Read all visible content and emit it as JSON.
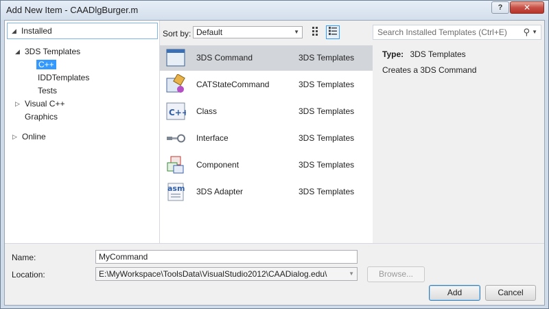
{
  "window": {
    "title": "Add New Item - CAADlgBurger.m",
    "help_label": "?",
    "close_label": "✕"
  },
  "tree": {
    "header": "Installed",
    "items": [
      {
        "label": "3DS Templates",
        "expanded": true
      },
      {
        "label": "C++",
        "selected": true
      },
      {
        "label": "IDDTemplates"
      },
      {
        "label": "Tests"
      },
      {
        "label": "Visual C++",
        "expanded": false
      },
      {
        "label": "Graphics"
      },
      {
        "label": "Online",
        "expanded": false
      }
    ]
  },
  "sortbar": {
    "label": "Sort by:",
    "value": "Default"
  },
  "templates": [
    {
      "name": "3DS Command",
      "category": "3DS Templates",
      "icon": "window-icon",
      "selected": true
    },
    {
      "name": "CATStateCommand",
      "category": "3DS Templates",
      "icon": "state-command-icon"
    },
    {
      "name": "Class",
      "category": "3DS Templates",
      "icon": "cpp-class-icon"
    },
    {
      "name": "Interface",
      "category": "3DS Templates",
      "icon": "interface-icon"
    },
    {
      "name": "Component",
      "category": "3DS Templates",
      "icon": "component-icon"
    },
    {
      "name": "3DS Adapter",
      "category": "3DS Templates",
      "icon": "asm-icon"
    }
  ],
  "details": {
    "search_placeholder": "Search Installed Templates (Ctrl+E)",
    "type_label": "Type:",
    "type_value": "3DS Templates",
    "description": "Creates a 3DS Command"
  },
  "form": {
    "name_label": "Name:",
    "name_value": "MyCommand",
    "location_label": "Location:",
    "location_value": "E:\\MyWorkspace\\ToolsData\\VisualStudio2012\\CAADialog.edu\\",
    "browse_label": "Browse...",
    "add_label": "Add",
    "cancel_label": "Cancel"
  }
}
